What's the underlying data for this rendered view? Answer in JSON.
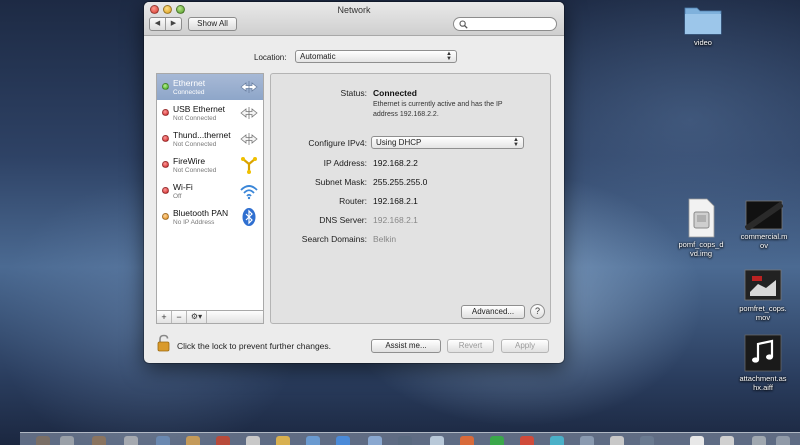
{
  "window": {
    "title": "Network",
    "show_all_label": "Show All",
    "nav_back": "◀",
    "nav_forward": "▶",
    "search_placeholder": ""
  },
  "location": {
    "label": "Location:",
    "value": "Automatic"
  },
  "services": [
    {
      "name": "Ethernet",
      "status": "Connected",
      "dot": "green",
      "icon": "ethernet-arrows-icon",
      "selected": true
    },
    {
      "name": "USB Ethernet",
      "status": "Not Connected",
      "dot": "red",
      "icon": "ethernet-arrows-icon"
    },
    {
      "name": "Thund...thernet",
      "status": "Not Connected",
      "dot": "red",
      "icon": "ethernet-arrows-icon"
    },
    {
      "name": "FireWire",
      "status": "Not Connected",
      "dot": "red",
      "icon": "firewire-icon"
    },
    {
      "name": "Wi-Fi",
      "status": "Off",
      "dot": "red",
      "icon": "wifi-icon"
    },
    {
      "name": "Bluetooth PAN",
      "status": "No IP Address",
      "dot": "orange",
      "icon": "bluetooth-icon"
    }
  ],
  "service_toolbar": {
    "add": "+",
    "remove": "−",
    "gear": "⚙▾"
  },
  "detail": {
    "status_label": "Status:",
    "status_value": "Connected",
    "status_description": "Ethernet is currently active and has the IP address 192.168.2.2.",
    "configure_label": "Configure IPv4:",
    "configure_value": "Using DHCP",
    "ip_label": "IP Address:",
    "ip_value": "192.168.2.2",
    "subnet_label": "Subnet Mask:",
    "subnet_value": "255.255.255.0",
    "router_label": "Router:",
    "router_value": "192.168.2.1",
    "dns_label": "DNS Server:",
    "dns_value": "192.168.2.1",
    "search_domains_label": "Search Domains:",
    "search_domains_value": "Belkin",
    "advanced_label": "Advanced...",
    "help_label": "?"
  },
  "footer": {
    "lock_text": "Click the lock to prevent further changes.",
    "assist_label": "Assist me...",
    "revert_label": "Revert",
    "apply_label": "Apply"
  },
  "desktop_icons": [
    {
      "label": "video",
      "icon": "folder-icon"
    },
    {
      "label": "pomf_cops_d\nvd.img",
      "icon": "disk-image-icon"
    },
    {
      "label": "commercial.m\nov",
      "icon": "movie-icon"
    },
    {
      "label": "pomfret_cops.\nmov",
      "icon": "movie-icon"
    },
    {
      "label": "attachment.as\nhx.aiff",
      "icon": "music-file-icon"
    }
  ],
  "colors": {
    "selection": "#8ea6c9",
    "status_green": "#39a81a",
    "status_red": "#cc1f1f",
    "status_orange": "#e38a12"
  }
}
